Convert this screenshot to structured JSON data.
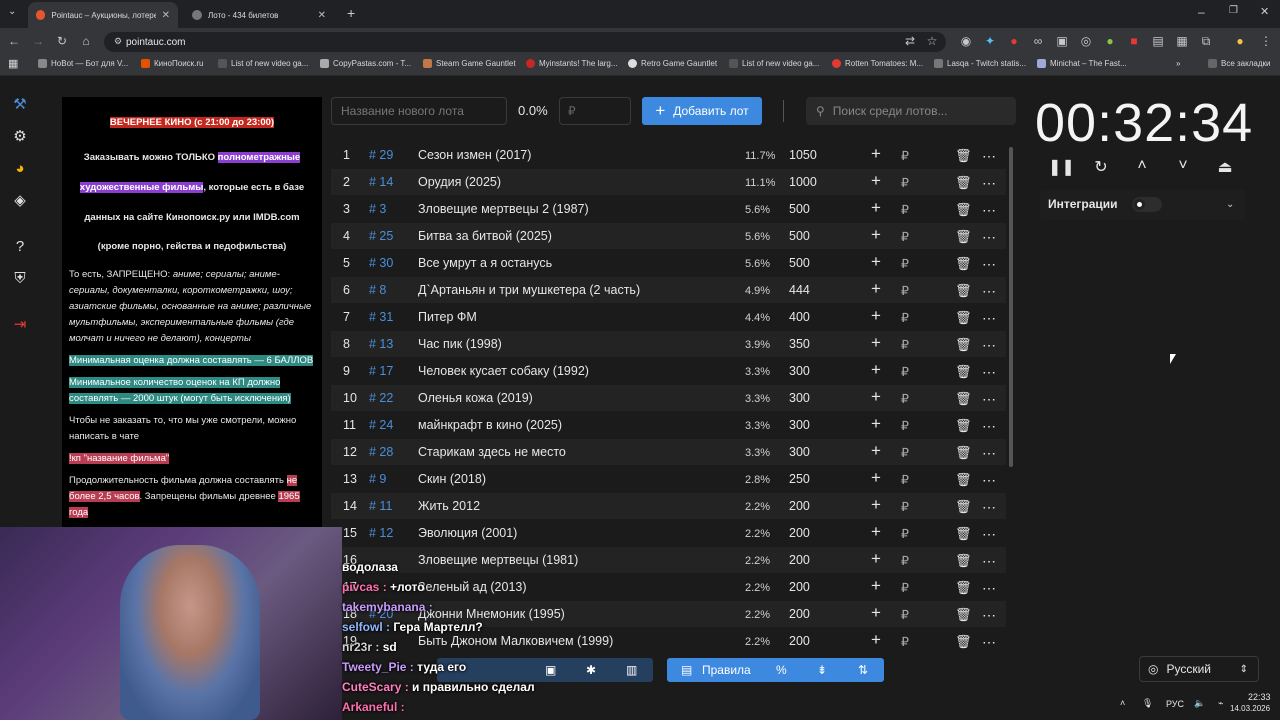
{
  "browser": {
    "tabs": [
      {
        "title": "Pointauc – Аукционы, лотереи",
        "active": true
      },
      {
        "title": "Лото - 434 билетов",
        "active": false
      }
    ],
    "url": "pointauc.com",
    "bookmarks": [
      "HoBot — Бот для V...",
      "КиноПоиск.ru",
      "List of new video ga...",
      "CopyPastas.com - T...",
      "Steam Game Gauntlet",
      "Myinstants! The larg...",
      "Retro Game Gauntlet",
      "List of new video ga...",
      "Rotten Tomatoes: M...",
      "Lasqa - Twitch statis...",
      "Minichat – The Fast..."
    ],
    "all_bookmarks": "Все закладки"
  },
  "rules": {
    "title": "ВЕЧЕРНЕЕ КИНО (с 21:00 до 23:00)",
    "p1_a": "Заказывать можно ТОЛЬКО ",
    "p1_hl": "полнометражные художественные фильмы",
    "p1_b": ", которые есть в базе данных на сайте Кинопоиск.ру или IMDB.com",
    "p1_c": "(кроме порно, гейства и педофильства)",
    "p2_a": "То есть, ЗАПРЕЩЕНО: ",
    "p2_b": "аниме; сериалы; аниме-сериалы, документалки, короткометражки, шоу; азиатские фильмы, основанные на аниме; различные мультфильмы, экспериментальные фильмы (где молчат и ничего не делают), концерты",
    "p3": "Минимальная оценка должна составлять — 6 БАЛЛОВ",
    "p4": "Минимальное количество оценок на КП должно составлять — 2000 штук (могут быть исключения)",
    "p5": "Чтобы не заказать то, что мы уже смотрели, можно написать в чате",
    "p6": "!кп \"название фильма\"",
    "p7_a": "Продолжительность фильма должна составлять ",
    "p7_hl": "не более 2,5 часов",
    "p7_b": ". Запрещены фильмы древнее ",
    "p7_hl2": "1965 года"
  },
  "controls": {
    "new_lot_placeholder": "Название нового лота",
    "percent": "0.0%",
    "currency_placeholder": "₽",
    "add_button": "Добавить лот",
    "search_placeholder": "Поиск среди лотов..."
  },
  "lots": [
    {
      "n": "1",
      "id": "# 29",
      "name": "Сезон измен (2017)",
      "pct": "11.7%",
      "amount": "1050"
    },
    {
      "n": "2",
      "id": "# 14",
      "name": "Орудия (2025)",
      "pct": "11.1%",
      "amount": "1000"
    },
    {
      "n": "3",
      "id": "# 3",
      "name": "Зловещие мертвецы 2 (1987)",
      "pct": "5.6%",
      "amount": "500"
    },
    {
      "n": "4",
      "id": "# 25",
      "name": "Битва за битвой (2025)",
      "pct": "5.6%",
      "amount": "500"
    },
    {
      "n": "5",
      "id": "# 30",
      "name": "Все умрут а я останусь",
      "pct": "5.6%",
      "amount": "500"
    },
    {
      "n": "6",
      "id": "# 8",
      "name": "Д`Артаньян и три мушкетера (2 часть)",
      "pct": "4.9%",
      "amount": "444"
    },
    {
      "n": "7",
      "id": "# 31",
      "name": "Питер ФМ",
      "pct": "4.4%",
      "amount": "400"
    },
    {
      "n": "8",
      "id": "# 13",
      "name": "Час пик (1998)",
      "pct": "3.9%",
      "amount": "350"
    },
    {
      "n": "9",
      "id": "# 17",
      "name": "Человек кусает собаку (1992)",
      "pct": "3.3%",
      "amount": "300"
    },
    {
      "n": "10",
      "id": "# 22",
      "name": "Оленья кожа (2019)",
      "pct": "3.3%",
      "amount": "300"
    },
    {
      "n": "11",
      "id": "# 24",
      "name": "майнкрафт в кино (2025)",
      "pct": "3.3%",
      "amount": "300"
    },
    {
      "n": "12",
      "id": "# 28",
      "name": "Старикам здесь не место",
      "pct": "3.3%",
      "amount": "300"
    },
    {
      "n": "13",
      "id": "# 9",
      "name": "Скин (2018)",
      "pct": "2.8%",
      "amount": "250"
    },
    {
      "n": "14",
      "id": "# 11",
      "name": "Жить 2012",
      "pct": "2.2%",
      "amount": "200"
    },
    {
      "n": "15",
      "id": "# 12",
      "name": "Эволюция (2001)",
      "pct": "2.2%",
      "amount": "200"
    },
    {
      "n": "16",
      "id": "",
      "name": "Зловещие мертвецы (1981)",
      "pct": "2.2%",
      "amount": "200"
    },
    {
      "n": "17",
      "id": "",
      "name": "Зеленый ад (2013)",
      "pct": "2.2%",
      "amount": "200"
    },
    {
      "n": "18",
      "id": "# 20",
      "name": "Джонни Мнемоник (1995)",
      "pct": "2.2%",
      "amount": "200"
    },
    {
      "n": "19",
      "id": "",
      "name": "Быть Джоном Малковичем (1999)",
      "pct": "2.2%",
      "amount": "200"
    }
  ],
  "timer": {
    "value": "00:32:34"
  },
  "integrations": {
    "label": "Интеграции"
  },
  "language": {
    "label": "Русский"
  },
  "bottom_tools": {
    "rules_label": "Правила"
  },
  "chat": [
    {
      "user": "водолаза",
      "text": "",
      "color": "#ffffff"
    },
    {
      "user": "pivcas :",
      "text": "+лото",
      "color": "#ff6fb0"
    },
    {
      "user": "takemybanana :",
      "text": "",
      "color": "#c99bff"
    },
    {
      "user": "selfowl :",
      "text": "Гера Мартелл?",
      "color": "#8fb8ff"
    },
    {
      "user": "nr23r :",
      "text": "sd",
      "color": "#d0d0d0"
    },
    {
      "user": "Tweety_Pie :",
      "text": "туда его",
      "color": "#c99bff"
    },
    {
      "user": "CuteScary :",
      "text": "и правильно сделал",
      "color": "#ff7fbf"
    },
    {
      "user": "Arkaneful :",
      "text": "",
      "color": "#ff6fb0"
    }
  ],
  "tray": {
    "lang": "РУС",
    "time": "22:33",
    "date": "14.03.2026"
  }
}
